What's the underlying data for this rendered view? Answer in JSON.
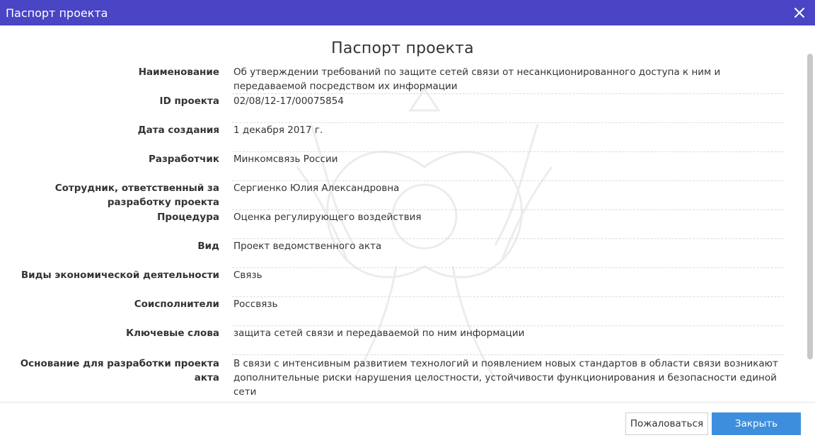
{
  "window": {
    "title": "Паспорт проекта",
    "close_icon": "close-icon"
  },
  "heading": "Паспорт проекта",
  "fields": [
    {
      "label": "Наименование",
      "value": "Об утверждении требований по защите сетей связи от несанкционированного доступа к ним и передаваемой посредством их информации"
    },
    {
      "label": "ID проекта",
      "value": "02/08/12-17/00075854"
    },
    {
      "label": "Дата создания",
      "value": "1 декабря 2017 г."
    },
    {
      "label": "Разработчик",
      "value": "Минкомсвязь России"
    },
    {
      "label": "Сотрудник, ответственный за разработку проекта",
      "value": "Сергиенко Юлия Александровна"
    },
    {
      "label": "Процедура",
      "value": "Оценка регулирующего воздействия"
    },
    {
      "label": "Вид",
      "value": "Проект ведомственного акта"
    },
    {
      "label": "Виды экономической деятельности",
      "value": "Связь"
    },
    {
      "label": "Соисполнители",
      "value": "Россвязь"
    },
    {
      "label": "Ключевые слова",
      "value": "защита сетей связи и передаваемой по ним информации"
    },
    {
      "label": "Основание для разработки проекта акта",
      "value": "В связи с интенсивным развитием технологий и появлением новых стандартов в области связи возникают дополнительные риски нарушения целостности, устойчивости функционирования и безопасности единой сети"
    }
  ],
  "footer": {
    "complain_label": "Пожаловаться",
    "close_label": "Закрыть"
  },
  "colors": {
    "titlebar": "#4a45c4",
    "primary_button": "#3d8fdd"
  }
}
